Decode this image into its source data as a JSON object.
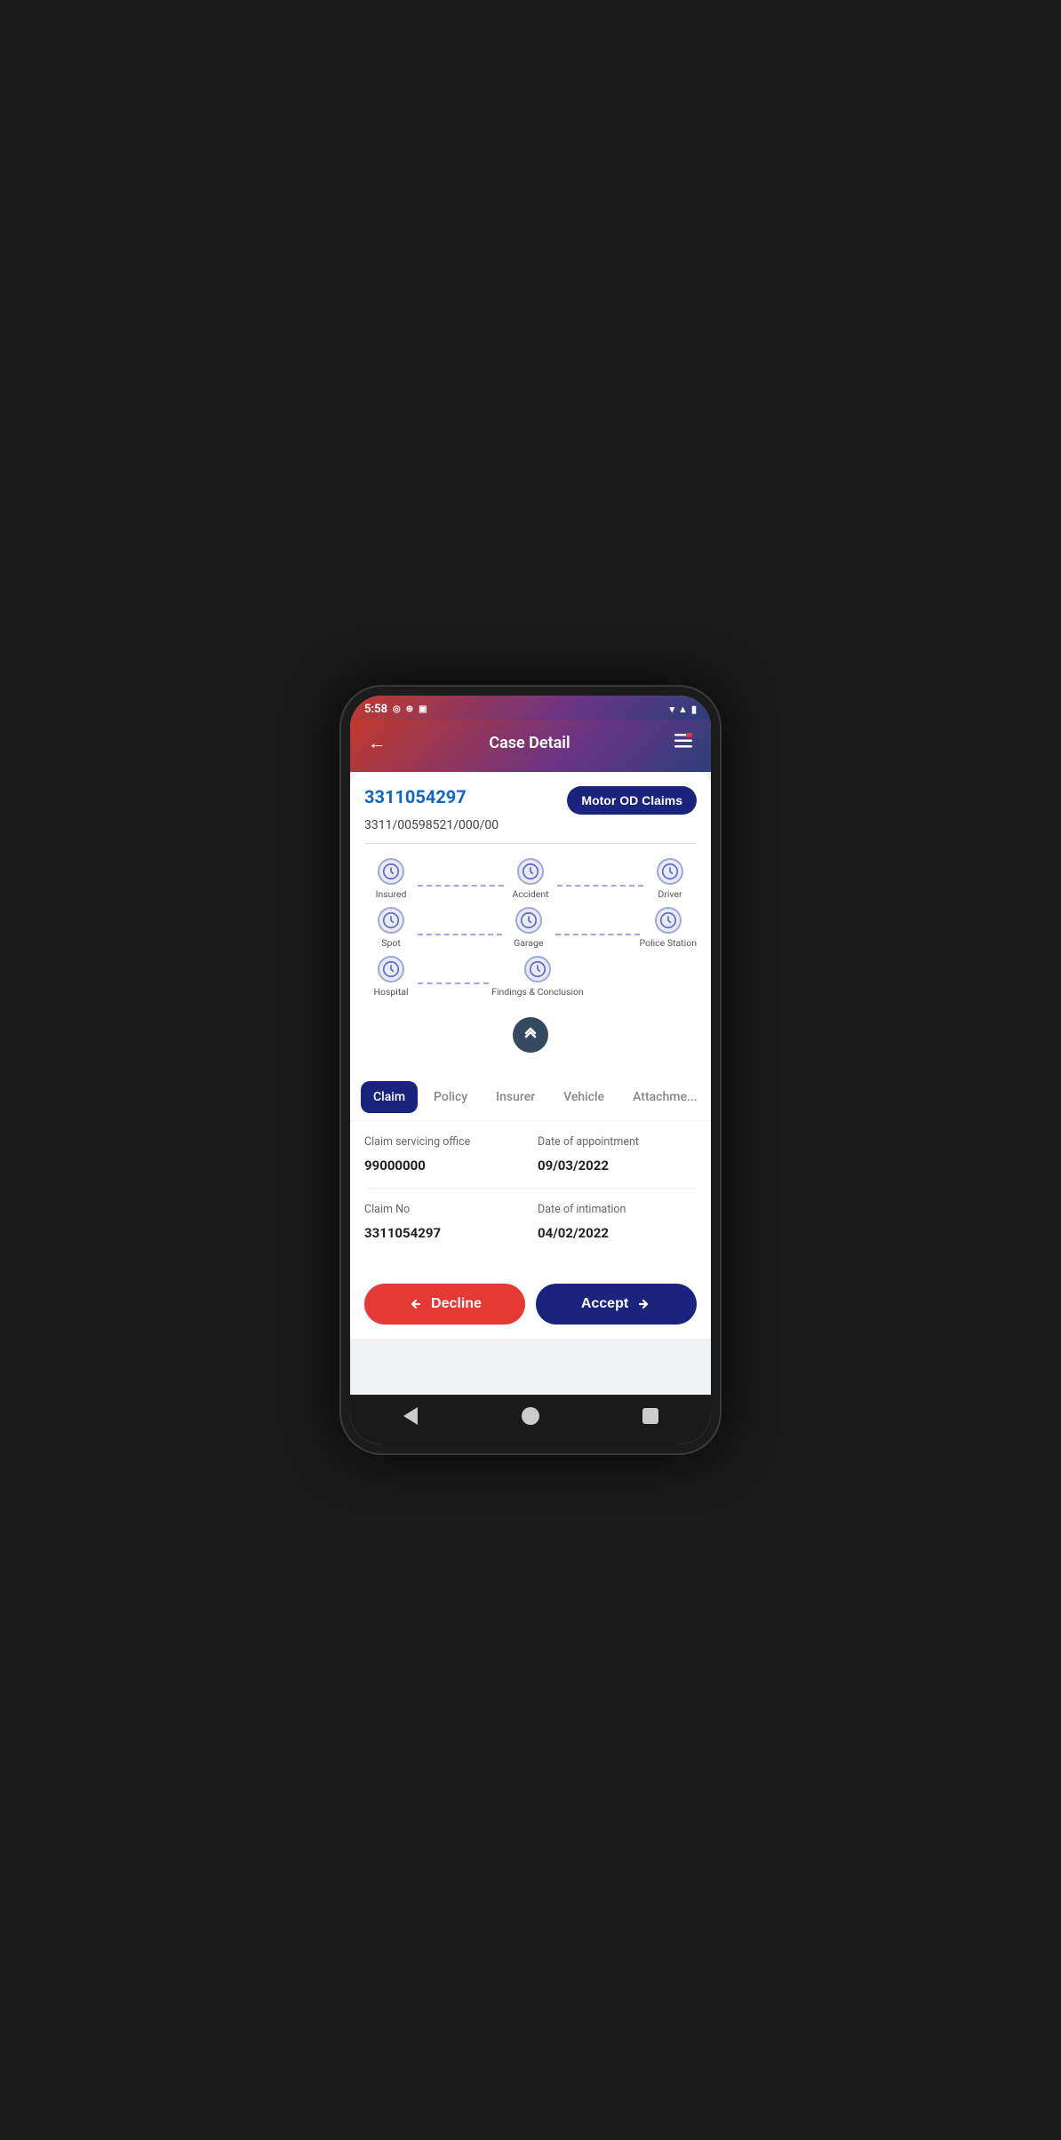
{
  "status_bar": {
    "time": "5:58",
    "icons": [
      "signal1",
      "signal2",
      "battery"
    ]
  },
  "header": {
    "title": "Case Detail",
    "back_label": "←",
    "menu_label": "≡"
  },
  "claim_card": {
    "claim_id": "3311054297",
    "tag": "Motor OD Claims",
    "policy_number": "3311/00598521/000/00"
  },
  "steps": {
    "row1": [
      {
        "label": "Insured"
      },
      {
        "label": "Accident"
      },
      {
        "label": "Driver"
      }
    ],
    "row2": [
      {
        "label": "Spot"
      },
      {
        "label": "Garage"
      },
      {
        "label": "Police Station"
      }
    ],
    "row3": [
      {
        "label": "Hospital"
      },
      {
        "label": "Findings & Conclusion"
      }
    ]
  },
  "tabs": [
    {
      "label": "Claim",
      "active": true
    },
    {
      "label": "Policy",
      "active": false
    },
    {
      "label": "Insurer",
      "active": false
    },
    {
      "label": "Vehicle",
      "active": false
    },
    {
      "label": "Attachme...",
      "active": false
    }
  ],
  "fields": {
    "claim_servicing_office": {
      "label": "Claim servicing office",
      "value": "99000000"
    },
    "date_of_appointment": {
      "label": "Date of appointment",
      "value": "09/03/2022"
    },
    "claim_no": {
      "label": "Claim No",
      "value": "3311054297"
    },
    "date_of_intimation": {
      "label": "Date of intimation",
      "value": "04/02/2022"
    }
  },
  "buttons": {
    "decline": "Decline",
    "accept": "Accept"
  },
  "colors": {
    "primary_blue": "#1a237e",
    "accent_red": "#e53935",
    "claim_id_blue": "#1565C0",
    "step_bg": "#e8eaf6",
    "step_border": "#9fa8da"
  }
}
